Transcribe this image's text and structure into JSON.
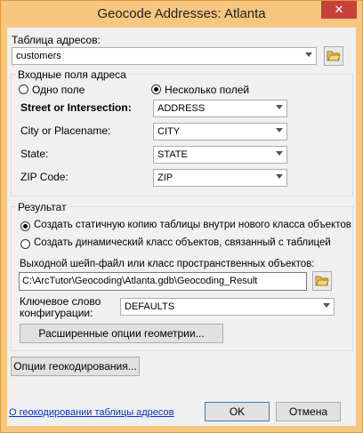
{
  "window": {
    "title": "Geocode Addresses: Atlanta",
    "close_glyph": "✕"
  },
  "address_table": {
    "label": "Таблица адресов:",
    "value": "customers"
  },
  "input_fields": {
    "group_title": "Входные поля адреса",
    "radio_single": "Одно поле",
    "radio_multiple": "Несколько полей",
    "rows": [
      {
        "label": "Street or Intersection:",
        "value": "ADDRESS"
      },
      {
        "label": "City or Placename:",
        "value": "CITY"
      },
      {
        "label": "State:",
        "value": "STATE"
      },
      {
        "label": "ZIP Code:",
        "value": "ZIP"
      }
    ]
  },
  "result": {
    "group_title": "Результат",
    "radio_static": "Создать статичную копию  таблицы внутри нового класса объектов",
    "radio_dynamic": "Создать динамический класс объектов, связанный с таблицей",
    "output_label": "Выходной шейп-файл или класс пространственных объектов:",
    "output_value": "C:\\ArcTutor\\Geocoding\\Atlanta.gdb\\Geocoding_Result",
    "config_label_line1": "Ключевое слово",
    "config_label_line2": "конфигурации:",
    "config_value": "DEFAULTS",
    "geometry_button": "Расширенные опции геометрии..."
  },
  "geocoding_options_button": "Опции геокодирования...",
  "footer": {
    "help_link": "О геокодировании таблицы адресов",
    "ok_button": "OK",
    "cancel_button": "Отмена"
  },
  "colors": {
    "frame": "#f7c680",
    "close": "#c7413a",
    "link": "#0033cc"
  },
  "icons": [
    "close-icon",
    "folder-open-icon",
    "dropdown-arrow-icon"
  ]
}
